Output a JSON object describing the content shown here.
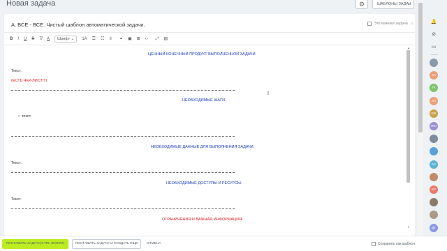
{
  "header": {
    "title": "Новая задача",
    "settings_icon": "gear-icon",
    "templates_label": "ШАБЛОНЫ ЗАДАЧ"
  },
  "task": {
    "title": "А. ВСЕ - ВСЕ. Чистый шаблон автоматической задачи.",
    "important_label": "Это важная задача"
  },
  "toolbar": {
    "bold": "B",
    "italic": "I",
    "underline": "U",
    "strike": "S",
    "clear_format": "T̸",
    "color": "A",
    "font_label": "Шрифт",
    "font_size": "1A"
  },
  "content": {
    "heading1": "ЦЕННЫЙ КОНЕЧНЫЙ ПРОДУКТ ВЫПОЛНЕННОЙ ЗАДАЧИ.",
    "text1": "Текст.",
    "checklist_note": "(ЕСТЬ ЧЕК-ЛИСТ!!!)",
    "heading2": "НЕОБХОДИМЫЕ ШАГИ.",
    "bullet1": "текст.",
    "heading3": "НЕОБХОДИМЫЕ ДАННЫЕ ДЛЯ ВЫПОЛНЕНИЯ ЗАДАЧИ.",
    "text2": "Текст.",
    "heading4": "НЕОБХОДИМЫЕ ДОСТУПЫ И РЕСУРСЫ.",
    "text3": "Текст.",
    "heading5": "ОГРАНИЧЕНИЯ И ВАЖНАЯ ИНФОРМАЦИЯ!"
  },
  "sidebar": {
    "avatars": [
      {
        "initials": "",
        "color": "#8a9aa8"
      },
      {
        "initials": "АА",
        "color": "#e8a07a"
      },
      {
        "initials": "ТК",
        "color": "#7ac36a"
      },
      {
        "initials": "АА",
        "color": "#e8a07a"
      },
      {
        "initials": "ЮК",
        "color": "#c9a24a"
      },
      {
        "initials": "ИЮ",
        "color": "#9a8fd6"
      },
      {
        "initials": "",
        "color": "#7f8c99"
      },
      {
        "initials": "",
        "color": "#5aa0d6"
      },
      {
        "initials": "АС",
        "color": "#5bb4d6"
      },
      {
        "initials": "",
        "color": "#c08a6a"
      },
      {
        "initials": "ЕР",
        "color": "#e87a6a"
      },
      {
        "initials": "",
        "color": "#8a7a6a"
      },
      {
        "initials": "",
        "color": "#a89a8a"
      },
      {
        "initials": "ДТ",
        "color": "#8a9ae0"
      },
      {
        "initials": "",
        "color": "#b0a090"
      }
    ]
  },
  "footer": {
    "submit_label": "ПОСТАВИТЬ ЗАДАЧУ(CTRL+ENTER)",
    "submit_create_label": "ПОСТАВИТЬ ЗАДАЧУ И СОЗДАТЬ ЕЩЕ",
    "cancel_label": "ОТМЕНА",
    "save_template_label": "Сохранить как шаблон"
  },
  "colors": {
    "accent_green": "#bbed21",
    "heading_blue": "#1a3fc2",
    "warning_red": "#e01818"
  }
}
